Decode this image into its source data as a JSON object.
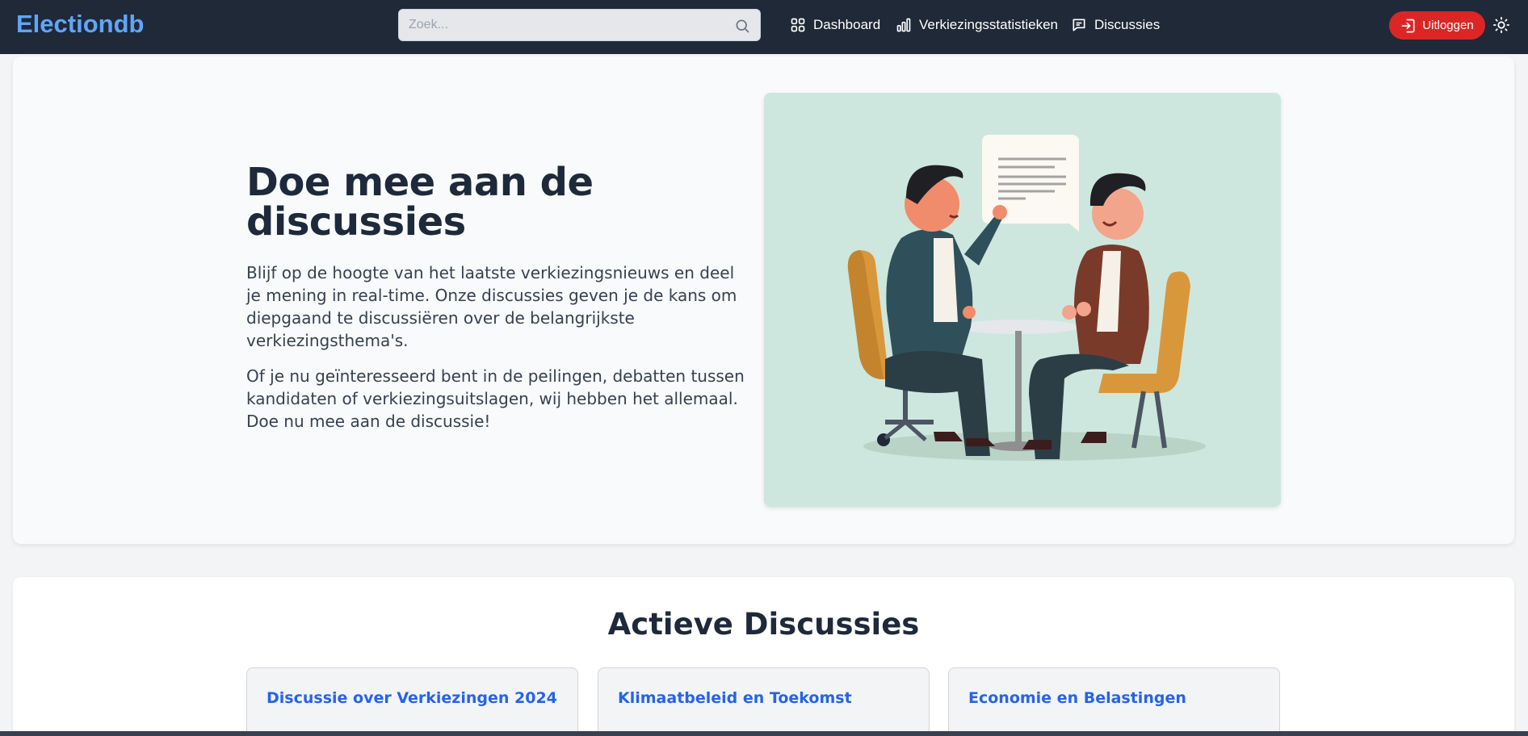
{
  "header": {
    "brand": "Electiondb",
    "search_placeholder": "Zoek...",
    "nav": [
      {
        "label": "Dashboard",
        "icon": "grid-icon"
      },
      {
        "label": "Verkiezingsstatistieken",
        "icon": "bar-chart-icon"
      },
      {
        "label": "Discussies",
        "icon": "chat-icon"
      }
    ],
    "logout_label": "Uitloggen",
    "colors": {
      "bar": "#1f2937",
      "brand": "#60a5fa",
      "logout": "#dc2626"
    }
  },
  "hero": {
    "title": "Doe mee aan de discussies",
    "paragraph1": "Blijf op de hoogte van het laatste verkiezingsnieuws en deel je mening in real-time. Onze discussies geven je de kans om diepgaand te discussiëren over de belangrijkste verkiezingsthema's.",
    "paragraph2": "Of je nu geïnteresseerd bent in de peilingen, debatten tussen kandidaten of verkiezingsuitslagen, wij hebben het allemaal. Doe nu mee aan de discussie!",
    "illustration": "two-men-discussing-illustration"
  },
  "active": {
    "title": "Actieve Discussies",
    "cards": [
      {
        "title": "Discussie over Verkiezingen 2024"
      },
      {
        "title": "Klimaatbeleid en Toekomst"
      },
      {
        "title": "Economie en Belastingen"
      }
    ],
    "link_color": "#2563eb"
  }
}
